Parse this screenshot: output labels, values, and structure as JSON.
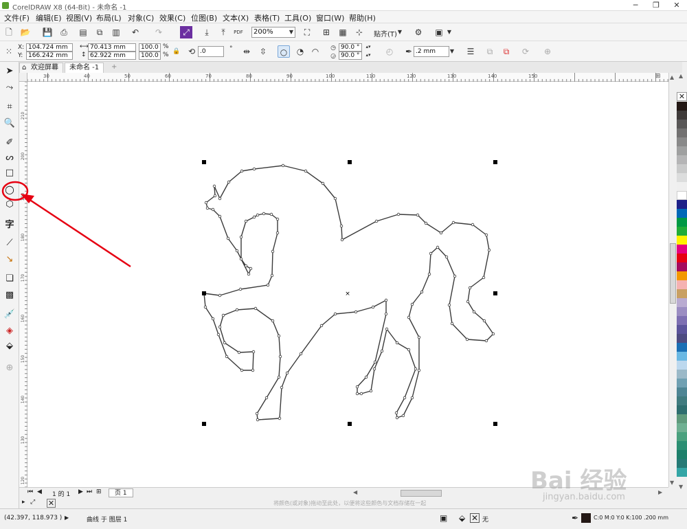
{
  "window": {
    "title": "CorelDRAW X8 (64-Bit) - 未命名 -1",
    "min": "─",
    "restore": "❐",
    "close": "✕"
  },
  "menu": [
    "文件(F)",
    "编辑(E)",
    "视图(V)",
    "布局(L)",
    "对象(C)",
    "效果(C)",
    "位图(B)",
    "文本(X)",
    "表格(T)",
    "工具(O)",
    "窗口(W)",
    "帮助(H)"
  ],
  "standard": {
    "zoom": "200%",
    "snap_label": "贴齐(T)",
    "pdf": "PDF"
  },
  "props": {
    "x_label": "X:",
    "x": "104.724 mm",
    "y_label": "Y:",
    "y": "166.242 mm",
    "width": "70.413 mm",
    "height": "62.922 mm",
    "scale_x": "100.0",
    "scale_y": "100.0",
    "pct": "%",
    "rotation": ".0",
    "deg": "°",
    "angle_start": "90.0 °",
    "angle_end": "90.0 °",
    "outline": ".2 mm"
  },
  "tabs": {
    "welcome": "欢迎屏幕",
    "doc": "未命名 -1",
    "add": "+"
  },
  "ruler_h": [
    "30",
    "40",
    "50",
    "60",
    "70",
    "80",
    "90",
    "100",
    "110",
    "120",
    "130",
    "140",
    "150"
  ],
  "ruler_v": [
    "210",
    "200",
    "190",
    "180",
    "170",
    "160",
    "150",
    "140",
    "130",
    "120"
  ],
  "pagebar": {
    "page_of": "1 的 1",
    "page_tab": "页 1"
  },
  "colorbar_hint": "将颜色(或对象)拖动至此处，以便将这些颜色与文档存储在一起",
  "status": {
    "coords": "(42.397, 118.973 )",
    "object_info": "曲线 于 图层 1",
    "fill_none": "无",
    "color_model": "C:0 M:0 Y:0 K:100 .200 mm"
  },
  "watermark": {
    "brand": "Bai 经验",
    "url": "jingyan.baidu.com"
  },
  "palette": [
    "#231815",
    "#3e3a39",
    "#595757",
    "#727171",
    "#898989",
    "#9fa0a0",
    "#b5b5b6",
    "#c9caca",
    "#dcdddd",
    "#efefef",
    "#ffffff",
    "#1d2088",
    "#0068b7",
    "#009944",
    "#22ac38",
    "#fff100",
    "#e4007f",
    "#e60012",
    "#a40b5d",
    "#f39800",
    "#f5b2b2",
    "#c9a063",
    "#b9abd1",
    "#9b8dc2",
    "#7d6fb2",
    "#5b549b",
    "#4d4b81",
    "#1a6fb5",
    "#6ab8e3",
    "#bcd8ee",
    "#9bb9c8",
    "#70a0b2",
    "#4e8594",
    "#407b7f",
    "#2e6e6f",
    "#5f9a7c",
    "#6fb092",
    "#4aa17e",
    "#2b8f73",
    "#1d7f6b",
    "#267a76",
    "#35a6a6"
  ],
  "colors": {
    "accent": "#1a6fb5",
    "annotation": "#e60012"
  }
}
